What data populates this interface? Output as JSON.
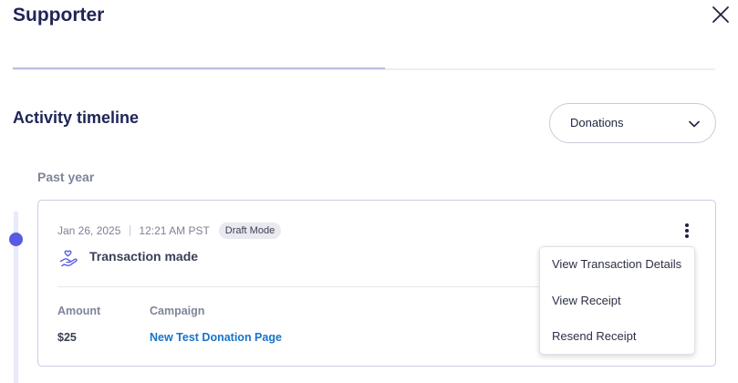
{
  "header": {
    "title": "Supporter",
    "close_icon": "close-icon"
  },
  "activity": {
    "title": "Activity timeline",
    "filter": {
      "value": "Donations",
      "icon": "chevron-down-icon"
    },
    "group_label": "Past year"
  },
  "event": {
    "date": "Jan 26, 2025",
    "time": "12:21 AM PST",
    "badge": "Draft Mode",
    "icon": "heart-hand-icon",
    "title": "Transaction made",
    "menu_icon": "kebab-menu-icon",
    "amount_label": "Amount",
    "amount_value": "$25",
    "campaign_label": "Campaign",
    "campaign_value": "New Test Donation Page"
  },
  "context_menu": {
    "items": [
      {
        "label": "View Transaction Details"
      },
      {
        "label": "View Receipt"
      },
      {
        "label": "Resend Receipt"
      }
    ]
  },
  "colors": {
    "heading": "#1f2456",
    "accent": "#5a5be3",
    "link": "#1a73c8",
    "muted": "#7f8499",
    "card_border": "#c8cde6"
  }
}
